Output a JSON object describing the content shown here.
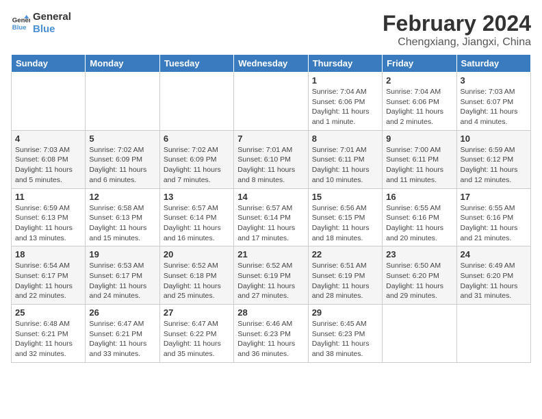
{
  "header": {
    "logo_line1": "General",
    "logo_line2": "Blue",
    "month_year": "February 2024",
    "location": "Chengxiang, Jiangxi, China"
  },
  "weekdays": [
    "Sunday",
    "Monday",
    "Tuesday",
    "Wednesday",
    "Thursday",
    "Friday",
    "Saturday"
  ],
  "weeks": [
    [
      {
        "day": "",
        "info": ""
      },
      {
        "day": "",
        "info": ""
      },
      {
        "day": "",
        "info": ""
      },
      {
        "day": "",
        "info": ""
      },
      {
        "day": "1",
        "info": "Sunrise: 7:04 AM\nSunset: 6:06 PM\nDaylight: 11 hours and 1 minute."
      },
      {
        "day": "2",
        "info": "Sunrise: 7:04 AM\nSunset: 6:06 PM\nDaylight: 11 hours and 2 minutes."
      },
      {
        "day": "3",
        "info": "Sunrise: 7:03 AM\nSunset: 6:07 PM\nDaylight: 11 hours and 4 minutes."
      }
    ],
    [
      {
        "day": "4",
        "info": "Sunrise: 7:03 AM\nSunset: 6:08 PM\nDaylight: 11 hours and 5 minutes."
      },
      {
        "day": "5",
        "info": "Sunrise: 7:02 AM\nSunset: 6:09 PM\nDaylight: 11 hours and 6 minutes."
      },
      {
        "day": "6",
        "info": "Sunrise: 7:02 AM\nSunset: 6:09 PM\nDaylight: 11 hours and 7 minutes."
      },
      {
        "day": "7",
        "info": "Sunrise: 7:01 AM\nSunset: 6:10 PM\nDaylight: 11 hours and 8 minutes."
      },
      {
        "day": "8",
        "info": "Sunrise: 7:01 AM\nSunset: 6:11 PM\nDaylight: 11 hours and 10 minutes."
      },
      {
        "day": "9",
        "info": "Sunrise: 7:00 AM\nSunset: 6:11 PM\nDaylight: 11 hours and 11 minutes."
      },
      {
        "day": "10",
        "info": "Sunrise: 6:59 AM\nSunset: 6:12 PM\nDaylight: 11 hours and 12 minutes."
      }
    ],
    [
      {
        "day": "11",
        "info": "Sunrise: 6:59 AM\nSunset: 6:13 PM\nDaylight: 11 hours and 13 minutes."
      },
      {
        "day": "12",
        "info": "Sunrise: 6:58 AM\nSunset: 6:13 PM\nDaylight: 11 hours and 15 minutes."
      },
      {
        "day": "13",
        "info": "Sunrise: 6:57 AM\nSunset: 6:14 PM\nDaylight: 11 hours and 16 minutes."
      },
      {
        "day": "14",
        "info": "Sunrise: 6:57 AM\nSunset: 6:14 PM\nDaylight: 11 hours and 17 minutes."
      },
      {
        "day": "15",
        "info": "Sunrise: 6:56 AM\nSunset: 6:15 PM\nDaylight: 11 hours and 18 minutes."
      },
      {
        "day": "16",
        "info": "Sunrise: 6:55 AM\nSunset: 6:16 PM\nDaylight: 11 hours and 20 minutes."
      },
      {
        "day": "17",
        "info": "Sunrise: 6:55 AM\nSunset: 6:16 PM\nDaylight: 11 hours and 21 minutes."
      }
    ],
    [
      {
        "day": "18",
        "info": "Sunrise: 6:54 AM\nSunset: 6:17 PM\nDaylight: 11 hours and 22 minutes."
      },
      {
        "day": "19",
        "info": "Sunrise: 6:53 AM\nSunset: 6:17 PM\nDaylight: 11 hours and 24 minutes."
      },
      {
        "day": "20",
        "info": "Sunrise: 6:52 AM\nSunset: 6:18 PM\nDaylight: 11 hours and 25 minutes."
      },
      {
        "day": "21",
        "info": "Sunrise: 6:52 AM\nSunset: 6:19 PM\nDaylight: 11 hours and 27 minutes."
      },
      {
        "day": "22",
        "info": "Sunrise: 6:51 AM\nSunset: 6:19 PM\nDaylight: 11 hours and 28 minutes."
      },
      {
        "day": "23",
        "info": "Sunrise: 6:50 AM\nSunset: 6:20 PM\nDaylight: 11 hours and 29 minutes."
      },
      {
        "day": "24",
        "info": "Sunrise: 6:49 AM\nSunset: 6:20 PM\nDaylight: 11 hours and 31 minutes."
      }
    ],
    [
      {
        "day": "25",
        "info": "Sunrise: 6:48 AM\nSunset: 6:21 PM\nDaylight: 11 hours and 32 minutes."
      },
      {
        "day": "26",
        "info": "Sunrise: 6:47 AM\nSunset: 6:21 PM\nDaylight: 11 hours and 33 minutes."
      },
      {
        "day": "27",
        "info": "Sunrise: 6:47 AM\nSunset: 6:22 PM\nDaylight: 11 hours and 35 minutes."
      },
      {
        "day": "28",
        "info": "Sunrise: 6:46 AM\nSunset: 6:23 PM\nDaylight: 11 hours and 36 minutes."
      },
      {
        "day": "29",
        "info": "Sunrise: 6:45 AM\nSunset: 6:23 PM\nDaylight: 11 hours and 38 minutes."
      },
      {
        "day": "",
        "info": ""
      },
      {
        "day": "",
        "info": ""
      }
    ]
  ]
}
